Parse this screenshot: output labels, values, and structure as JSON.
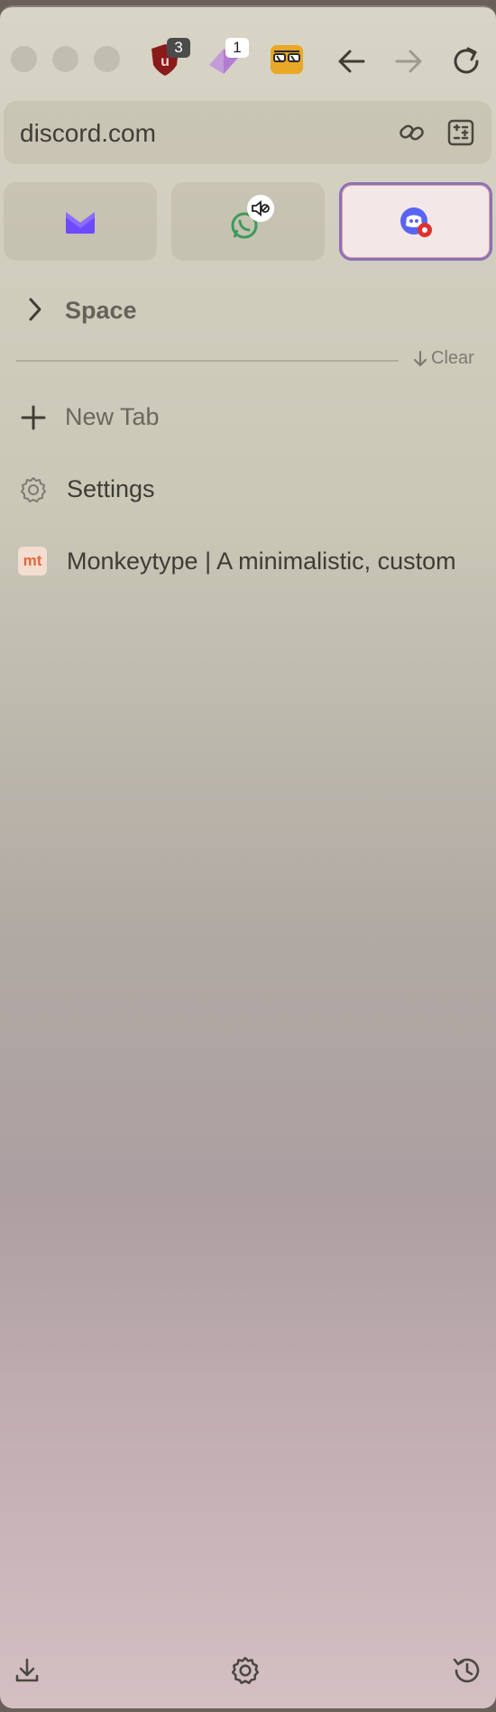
{
  "window": {
    "controls": [
      "close",
      "minimize",
      "zoom"
    ]
  },
  "extensions": [
    {
      "name": "ublock-origin",
      "badge": "3",
      "color": "#8b1a1a"
    },
    {
      "name": "extension-diamond",
      "badge": "1",
      "color": "#b58ad8"
    },
    {
      "name": "extension-glasses",
      "badge": "",
      "color": "#e9a825"
    }
  ],
  "toolbar": {
    "back_icon": "arrow-left",
    "forward_icon": "arrow-right",
    "reload_icon": "reload"
  },
  "address_bar": {
    "url": "discord.com",
    "copy_link_icon": "link-icon",
    "site_settings_icon": "sliders-icon"
  },
  "pinned_tabs": [
    {
      "name": "proton-mail",
      "icon": "mail-icon",
      "active": false
    },
    {
      "name": "whatsapp",
      "icon": "whatsapp-icon",
      "muted": true,
      "active": false
    },
    {
      "name": "discord",
      "icon": "discord-icon",
      "active": true
    }
  ],
  "space": {
    "label": "Space"
  },
  "clear": {
    "label": "Clear"
  },
  "tabs": [
    {
      "label": "New Tab",
      "icon": "plus-icon"
    },
    {
      "label": "Settings",
      "icon": "gear-icon"
    },
    {
      "label": "Monkeytype | A minimalistic, custom",
      "icon": "monkeytype-icon",
      "favicon_text": "mt"
    }
  ],
  "bottom_bar": {
    "left": "download-icon",
    "center": "gear-icon",
    "right": "history-icon"
  }
}
